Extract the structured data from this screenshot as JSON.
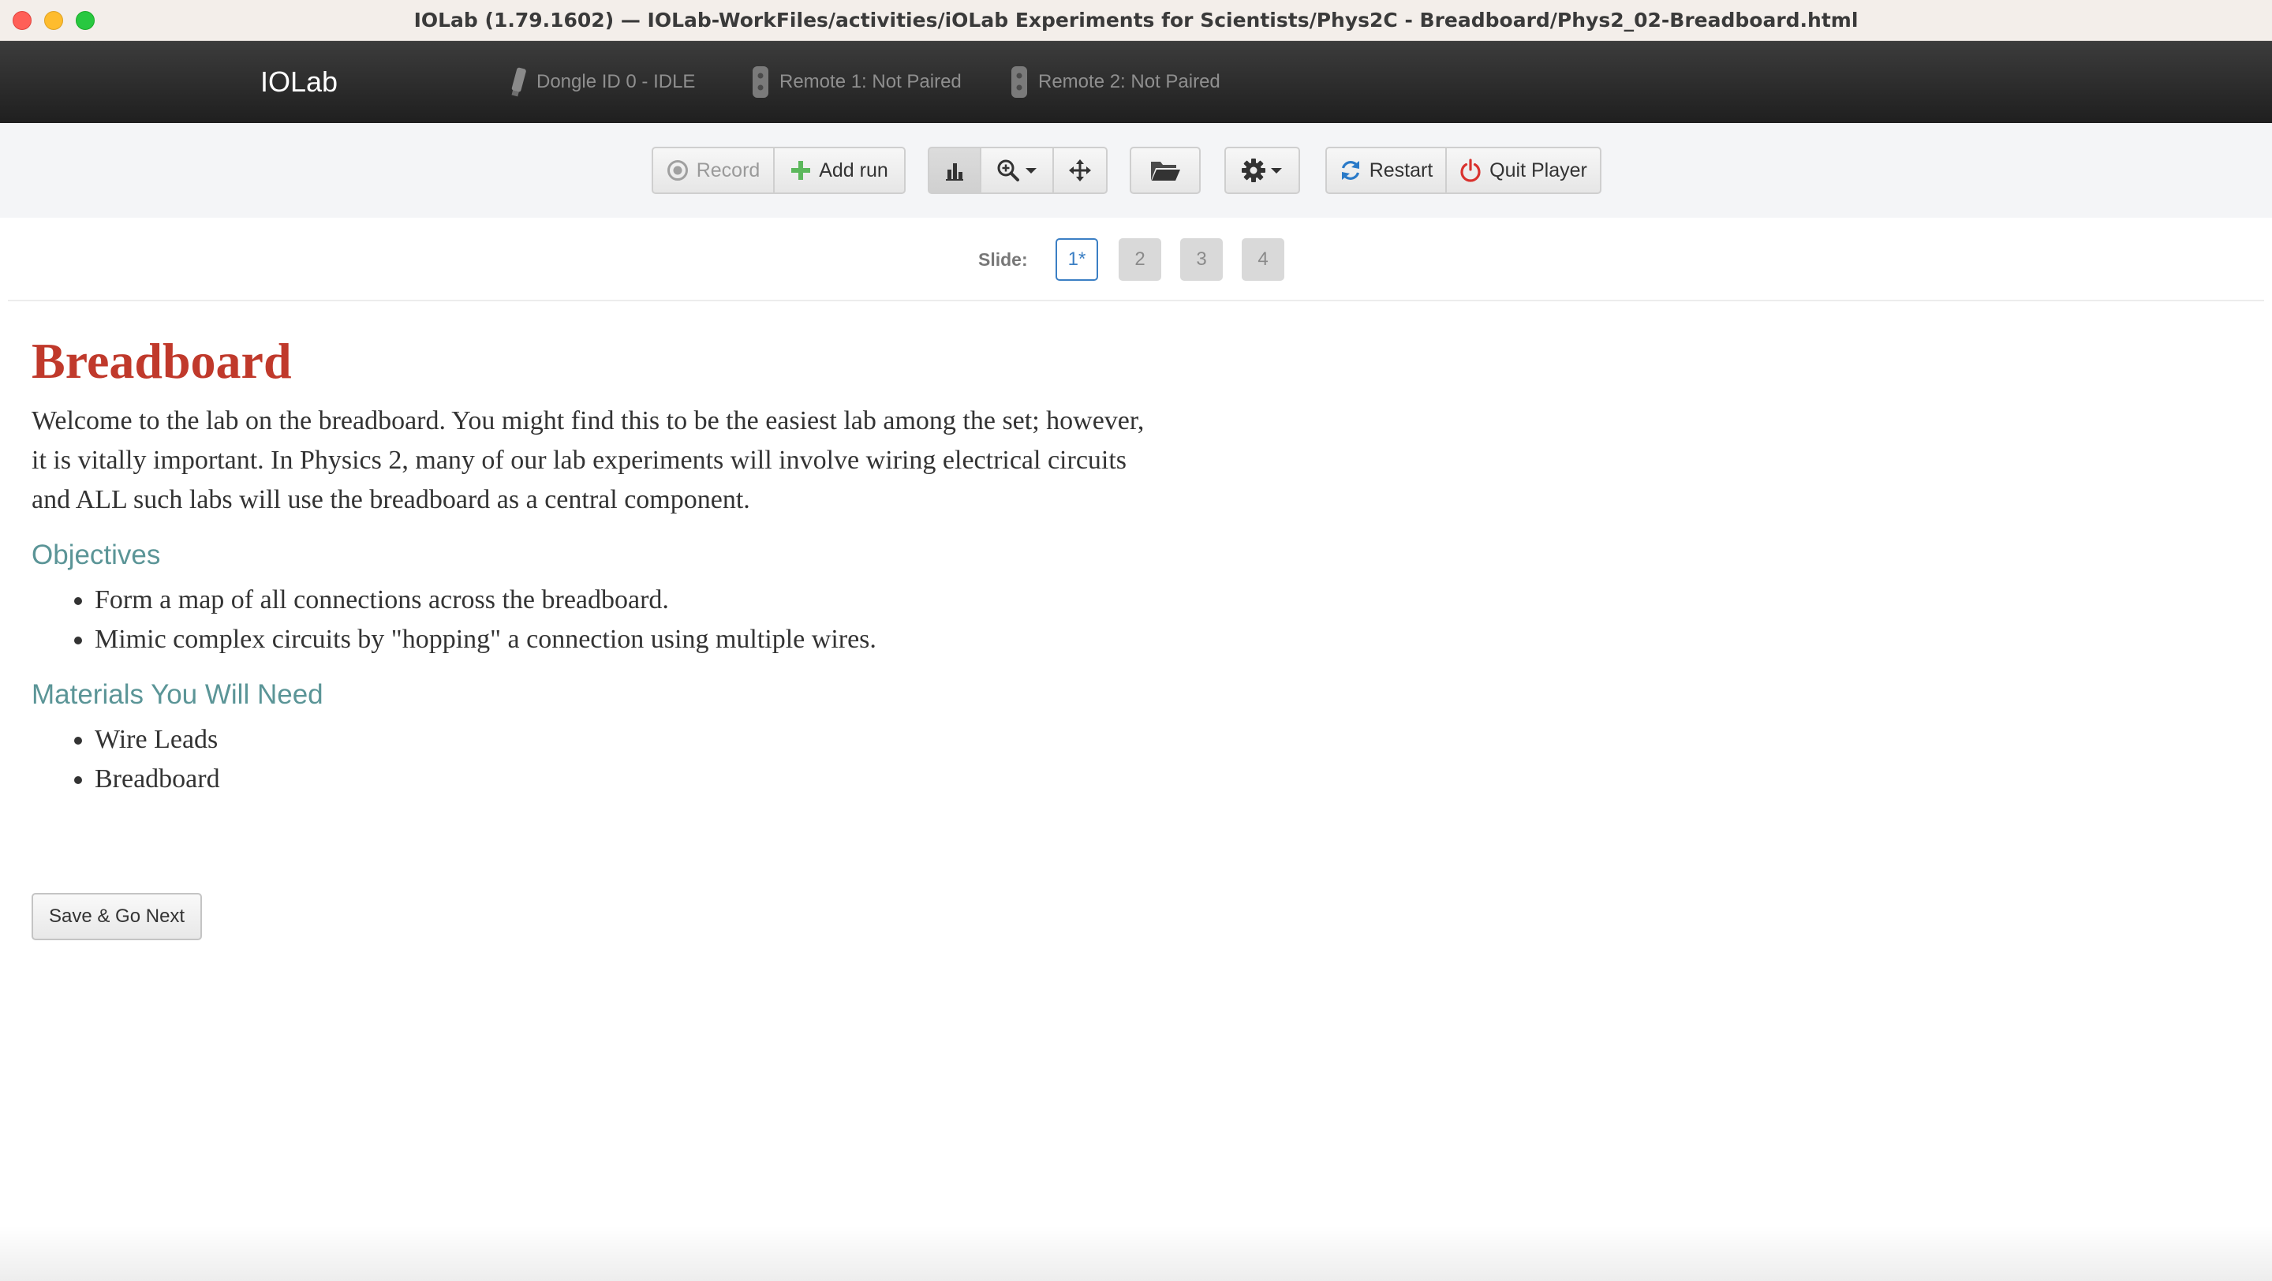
{
  "window": {
    "title": "IOLab (1.79.1602) — IOLab-WorkFiles/activities/iOLab Experiments for Scientists/Phys2C - Breadboard/Phys2_02-Breadboard.html"
  },
  "navbar": {
    "brand": "IOLab",
    "dongle_status": "Dongle ID 0 - IDLE",
    "remote1_status": "Remote 1: Not Paired",
    "remote2_status": "Remote 2: Not Paired"
  },
  "toolbar": {
    "record_label": "Record",
    "add_run_label": "Add run",
    "restart_label": "Restart",
    "quit_label": "Quit Player",
    "icons": {
      "record": "record-icon",
      "add_run": "plus-icon",
      "chart": "bar-chart-icon",
      "zoom": "zoom-in-icon",
      "pan": "move-arrows-icon",
      "folder": "folder-open-icon",
      "settings": "gear-icon",
      "restart": "refresh-icon",
      "quit": "power-icon"
    }
  },
  "slides": {
    "label": "Slide:",
    "items": [
      "1*",
      "2",
      "3",
      "4"
    ],
    "current_index": 0
  },
  "content": {
    "title": "Breadboard",
    "intro": "Welcome to the lab on the breadboard. You might find this to be the easiest lab among the set; however, it is vitally important. In Physics 2, many of our lab experiments will involve wiring electrical circuits and ALL such labs will use the breadboard as a central component.",
    "objectives_heading": "Objectives",
    "objectives": [
      "Form a map of all connections across the breadboard.",
      "Mimic complex circuits by \"hopping\" a connection using multiple wires."
    ],
    "materials_heading": "Materials You Will Need",
    "materials": [
      "Wire Leads",
      "Breadboard"
    ],
    "save_next_label": "Save & Go Next"
  },
  "colors": {
    "title_red": "#c0392b",
    "heading_teal": "#5b9597",
    "slide_current_blue": "#3b7fc4",
    "add_green": "#5cb85c",
    "quit_red": "#d9322e",
    "restart_blue": "#2a7ac8"
  }
}
